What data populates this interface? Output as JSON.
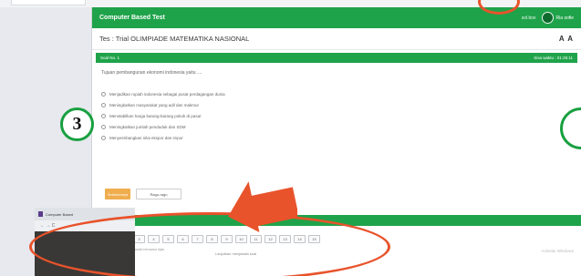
{
  "app": {
    "header_title": "Computer Based Test",
    "user_code": "sol.box",
    "user_name": "Ria sofie"
  },
  "test": {
    "title": "Tes : Trial OLIMPIADE MATEMATIKA NASIONAL",
    "font_size_control": "A A",
    "soal_label": "Soal No. 1",
    "soal_right": "Sisa waktu : 01:25:11",
    "question": "Tujuan pembangunan ekonomi indonesia yaitu ....",
    "options": [
      "Menjadikan rupiah indonesia sebagai pusat perdagangan dunia",
      "Meningkatkan masyarakat yang adil dan makmur",
      "Menstabilkan harga barang-barang pokok di pasar",
      "Meningkatkan jumlah penduduk dan SDM",
      "Menyeimbangkan nilai ekspor dan impor"
    ],
    "btn_prev": "Sebelumnya",
    "btn_doubt": "Ragu-ragu"
  },
  "annotation": {
    "step_number": "3"
  },
  "daftar": {
    "title": "Daftar Soal",
    "numbers": [
      "1",
      "2",
      "3",
      "4",
      "5",
      "6",
      "7",
      "8",
      "9",
      "10",
      "11",
      "12",
      "13",
      "14",
      "15"
    ],
    "note": "Nomor yang sudah dijawab berwarna hijau",
    "footer_left": "Lanjutkan menjawab soal",
    "footer_right": "Activate Windows"
  },
  "overlay": {
    "tab_label": "Computer Based",
    "nav": "←  →  C"
  },
  "colors": {
    "green": "#1fa34a",
    "red_annotation": "#e8532b",
    "orange_button": "#f0ad4e"
  }
}
